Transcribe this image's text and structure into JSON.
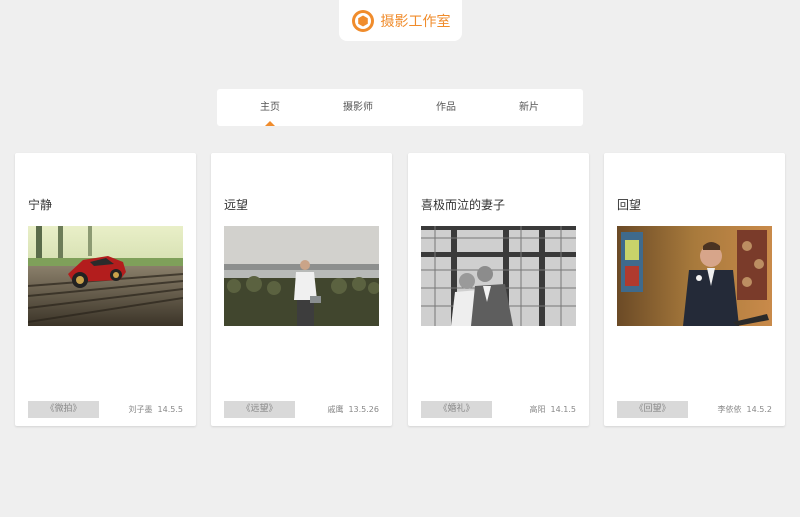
{
  "header": {
    "logo_icon": "aperture-icon",
    "site_name": "摄影工作室",
    "accent_color": "#f08c2c"
  },
  "nav": {
    "items": [
      {
        "label": "主页",
        "active": true
      },
      {
        "label": "摄影师",
        "active": false
      },
      {
        "label": "作品",
        "active": false
      },
      {
        "label": "新片",
        "active": false
      }
    ]
  },
  "cards": [
    {
      "title": "宁静",
      "photo": "red-toy-car-photo",
      "tag": "《微拍》",
      "author": "刘子墨",
      "date": "14.5.5"
    },
    {
      "title": "远望",
      "photo": "man-by-lake-photo",
      "tag": "《远望》",
      "author": "戚鹰",
      "date": "13.5.26"
    },
    {
      "title": "喜极而泣的妻子",
      "photo": "wedding-couple-bw-photo",
      "tag": "《婚礼》",
      "author": "高阳",
      "date": "14.1.5"
    },
    {
      "title": "回望",
      "photo": "groom-in-church-photo",
      "tag": "《回望》",
      "author": "李依依",
      "date": "14.5.2"
    }
  ]
}
